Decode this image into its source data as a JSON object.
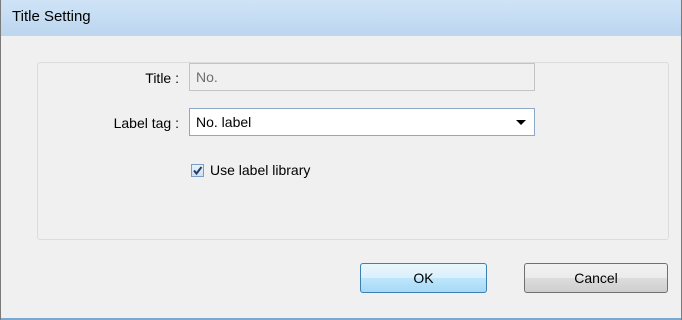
{
  "window": {
    "title": "Title Setting"
  },
  "form": {
    "title_label": "Title :",
    "title_value": "No.",
    "label_tag_label": "Label tag :",
    "label_tag_value": "No. label",
    "use_label_library_label": "Use label library",
    "use_label_library_checked": true
  },
  "buttons": {
    "ok": "OK",
    "cancel": "Cancel"
  },
  "icons": {
    "dropdown": "chevron-down-icon",
    "check": "checkmark-icon"
  }
}
